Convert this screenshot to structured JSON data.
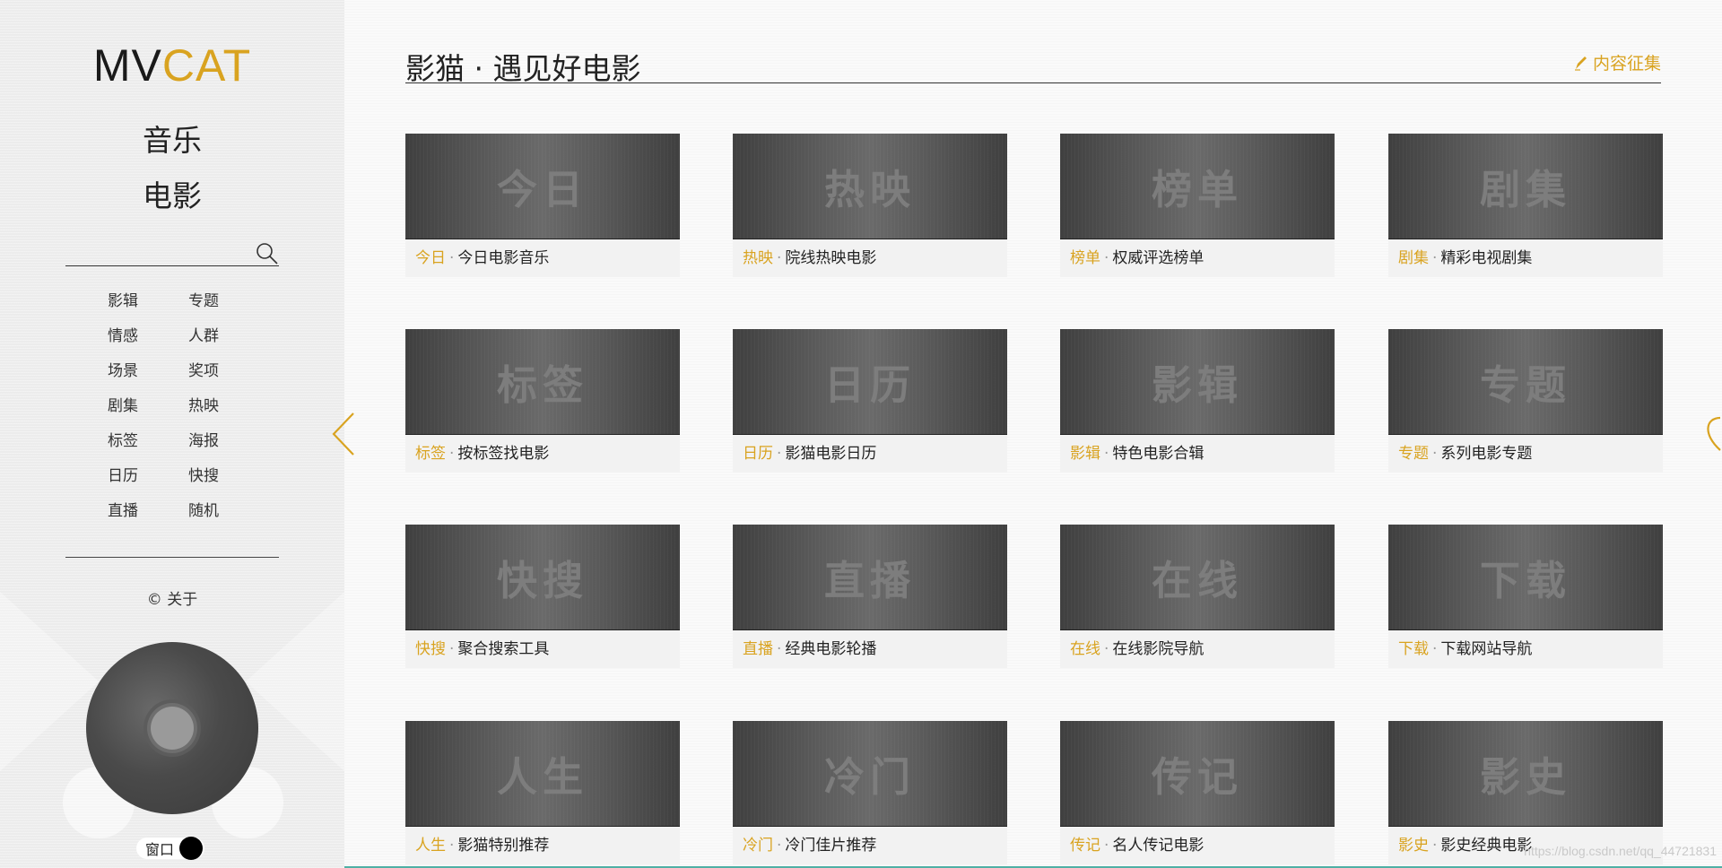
{
  "sidebar": {
    "logo": {
      "mv": "MV",
      "cat": "CAT"
    },
    "nav": {
      "music": "音乐",
      "movie": "电影"
    },
    "search": {
      "value": "",
      "placeholder": ""
    },
    "links": [
      "影辑",
      "专题",
      "情感",
      "人群",
      "场景",
      "奖项",
      "剧集",
      "热映",
      "标签",
      "海报",
      "日历",
      "快搜",
      "直播",
      "随机"
    ],
    "about": "© 关于",
    "window_toggle": "窗口"
  },
  "header": {
    "title": "影猫 · 遇见好电影",
    "contrib": "内容征集"
  },
  "cards": [
    {
      "title": "今日",
      "tag": "今日",
      "desc": "今日电影音乐"
    },
    {
      "title": "热映",
      "tag": "热映",
      "desc": "院线热映电影"
    },
    {
      "title": "榜单",
      "tag": "榜单",
      "desc": "权威评选榜单"
    },
    {
      "title": "剧集",
      "tag": "剧集",
      "desc": "精彩电视剧集"
    },
    {
      "title": "标签",
      "tag": "标签",
      "desc": "按标签找电影"
    },
    {
      "title": "日历",
      "tag": "日历",
      "desc": "影猫电影日历"
    },
    {
      "title": "影辑",
      "tag": "影辑",
      "desc": "特色电影合辑"
    },
    {
      "title": "专题",
      "tag": "专题",
      "desc": "系列电影专题"
    },
    {
      "title": "快搜",
      "tag": "快搜",
      "desc": "聚合搜索工具"
    },
    {
      "title": "直播",
      "tag": "直播",
      "desc": "经典电影轮播"
    },
    {
      "title": "在线",
      "tag": "在线",
      "desc": "在线影院导航"
    },
    {
      "title": "下载",
      "tag": "下载",
      "desc": "下载网站导航"
    },
    {
      "title": "人生",
      "tag": "人生",
      "desc": "影猫特别推荐"
    },
    {
      "title": "冷门",
      "tag": "冷门",
      "desc": "冷门佳片推荐"
    },
    {
      "title": "传记",
      "tag": "传记",
      "desc": "名人传记电影"
    },
    {
      "title": "影史",
      "tag": "影史",
      "desc": "影史经典电影"
    }
  ],
  "separator": "·",
  "watermark": "https://blog.csdn.net/qq_44721831",
  "colors": {
    "accent": "#d9a320",
    "text": "#222222",
    "card_bg": "#555555",
    "caption_bg": "#f2f2f2"
  },
  "icons": {
    "search": "search-icon",
    "pen": "pen-icon",
    "prev": "chevron-left-icon",
    "next": "chevron-right-icon"
  }
}
